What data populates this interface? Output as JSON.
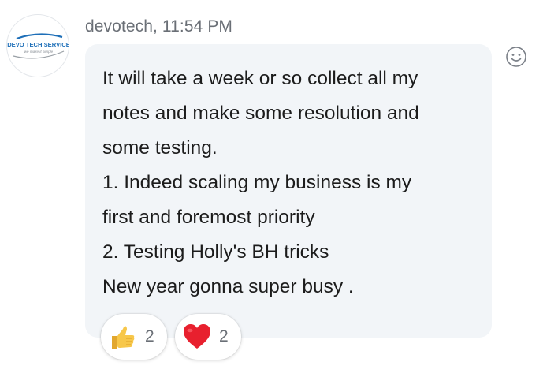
{
  "avatar": {
    "logo_text": "DEVO TECH SERVICE",
    "logo_tagline": "we make it simple"
  },
  "message": {
    "sender": "devotech",
    "time": "11:54 PM",
    "header": "devotech, 11:54 PM",
    "lines": [
      "It will take a week or so collect all my",
      "notes and make some resolution and",
      "some testing.",
      "1. Indeed scaling my business is my",
      "first and foremost priority",
      "2. Testing Holly's BH tricks",
      "New year gonna super busy ."
    ]
  },
  "reactions": [
    {
      "icon": "thumbs-up-icon",
      "count": "2"
    },
    {
      "icon": "heart-icon",
      "count": "2"
    }
  ],
  "add_reaction_icon": "smiley-icon",
  "colors": {
    "bubble": "#f2f5f8",
    "meta_text": "#6a6f76",
    "heart": "#e8202e",
    "thumb": "#f7c74a",
    "logo_blue": "#1e6fb8"
  }
}
